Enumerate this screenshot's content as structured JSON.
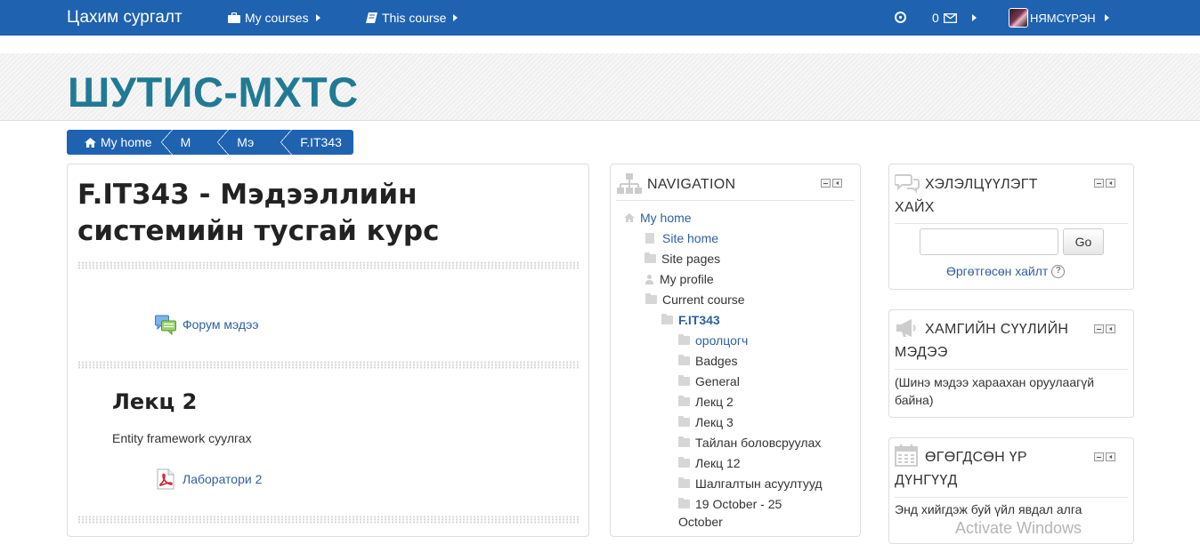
{
  "navbar": {
    "brand": "Цахим сургалт",
    "my_courses": "My courses",
    "this_course": "This course",
    "message_count": "0",
    "user_name": "НЯМСҮРЭН"
  },
  "header": {
    "site_title": "ШУТИС-МХТС"
  },
  "breadcrumb": [
    "My home",
    "M",
    "Мэ",
    "F.IT343"
  ],
  "main": {
    "course_title": "F.IT343 - Мэдээллийн системийн тусгай курс",
    "forum_link": "Форум мэдээ",
    "section_title": "Лекц 2",
    "section_summary": "Entity framework суулгах",
    "lab_link": "Лаборатори 2"
  },
  "navigation": {
    "title": "NAVIGATION",
    "my_home": "My home",
    "site_home": "Site home",
    "site_pages": "Site pages",
    "my_profile": "My profile",
    "current_course": "Current course",
    "course_code": "F.IT343",
    "sections": [
      "оролцогч",
      "Badges",
      "General",
      "Лекц 2",
      "Лекц 3",
      "Тайлан боловсруулах",
      "Лекц 12",
      "Шалгалтын асуултууд"
    ],
    "week_line1": "19 October - 25",
    "week_line2": "October"
  },
  "search_block": {
    "title_line1": "ХЭЛЭЛЦҮҮЛЭГТ",
    "title_line2": "ХАЙХ",
    "go": "Go",
    "advanced": "Өргөтгөсөн хайлт",
    "help": "?"
  },
  "news_block": {
    "title_line1": "ХАМГИЙН СҮҮЛИЙН",
    "title_line2": "МЭДЭЭ",
    "empty_line1": "(Шинэ мэдээ хараахан оруулаагүй",
    "empty_line2": "байна)"
  },
  "events_block": {
    "title_line1": "ӨГӨГДСӨН ҮР",
    "title_line2": "ДҮНГҮҮД",
    "text": "Энд хийгдэж буй үйл явдал алга"
  },
  "watermark": "Activate Windows",
  "colors": {
    "navbar": "#1f62b0",
    "title": "#217a94",
    "link": "#2f5fa0"
  }
}
